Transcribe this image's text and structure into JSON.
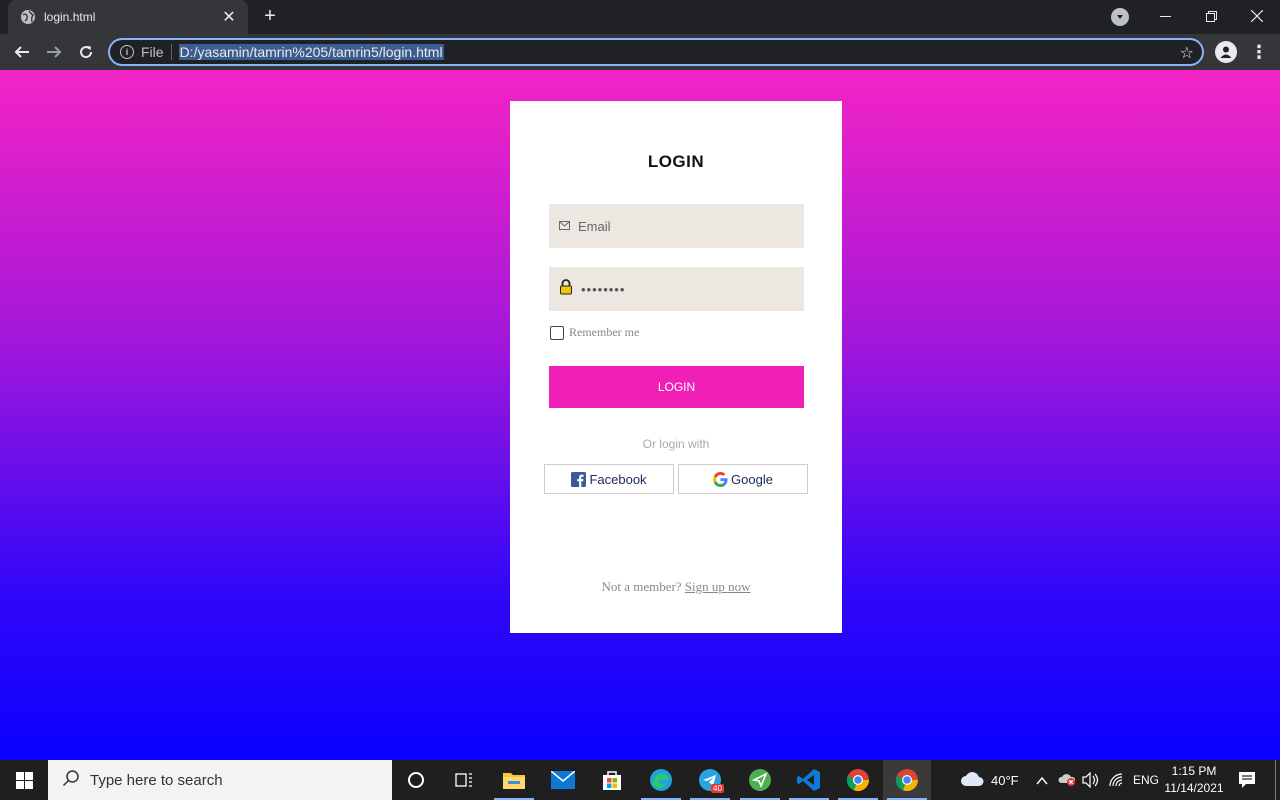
{
  "browser": {
    "tab_title": "login.html",
    "close_glyph": "✕",
    "newtab_glyph": "+",
    "scheme_label": "File",
    "url": "D:/yasamin/tamrin%205/tamrin5/login.html"
  },
  "login": {
    "title": "LOGIN",
    "email_placeholder": "Email",
    "password_value": "••••••••",
    "remember_label": "Remember me",
    "button_label": "LOGIN",
    "or_text": "Or login with",
    "facebook_label": "Facebook",
    "google_label": "Google",
    "signup_prompt": "Not a member?",
    "signup_link": "Sign up now",
    "button_color": "#f020b7",
    "gradient_top": "#f424c6",
    "gradient_bottom": "#0a00ff"
  },
  "taskbar": {
    "search_placeholder": "Type here to search",
    "telegram_badge": "40",
    "weather": "40°F",
    "language": "ENG",
    "time": "1:15 PM",
    "date": "11/14/2021"
  }
}
